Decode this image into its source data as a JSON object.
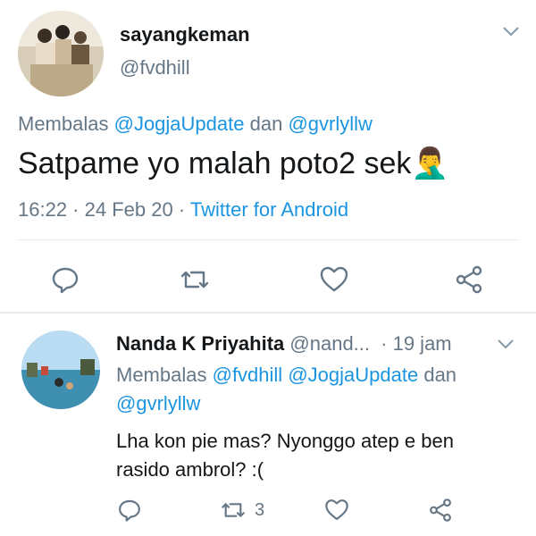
{
  "colors": {
    "link": "#1b95e0",
    "muted": "#657786",
    "text": "#14171a",
    "divider": "#e6ecf0"
  },
  "main_tweet": {
    "display_name": "sayangkeman",
    "handle": "@fvdhill",
    "reply_prefix": "Membalas",
    "reply_user_1": "@JogjaUpdate",
    "reply_join": "dan",
    "reply_user_2": "@gvrlyllw",
    "text": "Satpame yo malah poto2 sek",
    "emoji": "🤦‍♂️",
    "time": "16:22",
    "date": "24 Feb 20",
    "source": "Twitter for Android",
    "actions": {
      "reply": "reply-icon",
      "retweet": "retweet-icon",
      "like": "like-icon",
      "share": "share-icon"
    }
  },
  "reply_tweet": {
    "display_name": "Nanda K Priyahita",
    "handle": "@nand...",
    "time_ago": "· 19 jam",
    "reply_prefix": "Membalas",
    "reply_user_1": "@fvdhill",
    "reply_user_2": "@JogjaUpdate",
    "reply_join": "dan",
    "reply_user_3": "@gvrlyllw",
    "text_line_1": "Lha kon pie mas? Nyonggo atep e ben",
    "text_line_2": "rasido ambrol? :(",
    "retweet_count": "3"
  }
}
